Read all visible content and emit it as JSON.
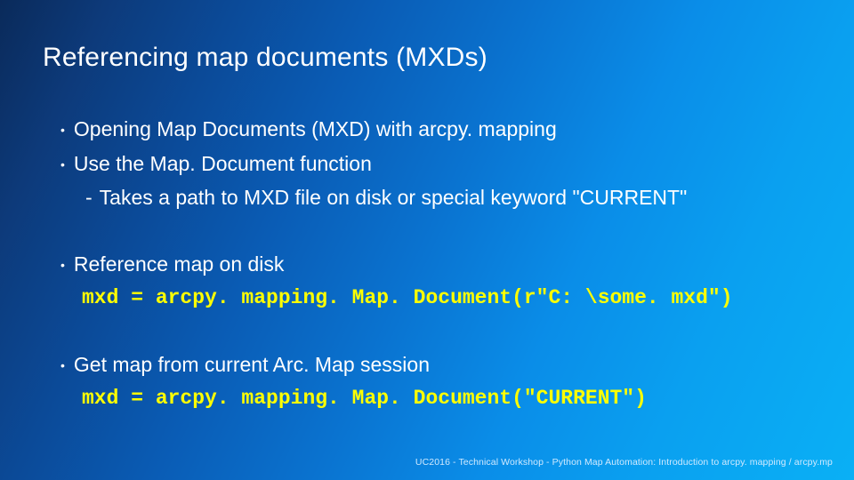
{
  "title": "Referencing map documents (MXDs)",
  "bullets": {
    "b1": "Opening Map Documents (MXD) with arcpy. mapping",
    "b2": "Use the Map. Document function",
    "b2sub": "Takes a path to MXD file on disk or special keyword \"CURRENT\"",
    "b3": "Reference map on disk",
    "b3code": "mxd = arcpy. mapping. Map. Document(r\"C: \\some. mxd\")",
    "b4": "Get map from current Arc. Map session",
    "b4code": "mxd = arcpy. mapping. Map. Document(\"CURRENT\")"
  },
  "footer": "UC2016 - Technical Workshop - Python Map Automation: Introduction to arcpy. mapping / arcpy.mp"
}
